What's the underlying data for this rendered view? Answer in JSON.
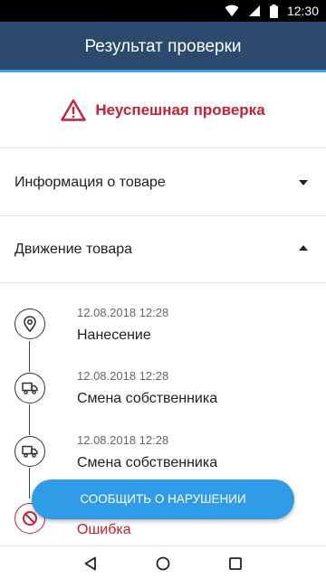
{
  "status_bar": {
    "time": "12:30"
  },
  "app_bar": {
    "title": "Результат проверки"
  },
  "result": {
    "label": "Неуспешная проверка",
    "color": "#c62234"
  },
  "sections": [
    {
      "label": "Информация о товаре",
      "state": "collapsed"
    },
    {
      "label": "Движение товара",
      "state": "expanded"
    }
  ],
  "timeline": [
    {
      "date": "12.08.2018 12:28",
      "title": "Нанесение",
      "icon": "location-pin-icon"
    },
    {
      "date": "12.08.2018 12:28",
      "title": "Смена собственника",
      "icon": "truck-icon"
    },
    {
      "date": "12.08.2018 12:28",
      "title": "Смена собственника",
      "icon": "truck-icon"
    },
    {
      "date": "",
      "title": "Ошибка",
      "icon": "prohibited-icon"
    }
  ],
  "report_button": {
    "label": "СООБЩИТЬ О НАРУШЕНИИ",
    "color": "#2f9ce8"
  },
  "colors": {
    "app_bar": "#2c4a6e",
    "accent_line": "#35a3ea",
    "error": "#c62234"
  }
}
